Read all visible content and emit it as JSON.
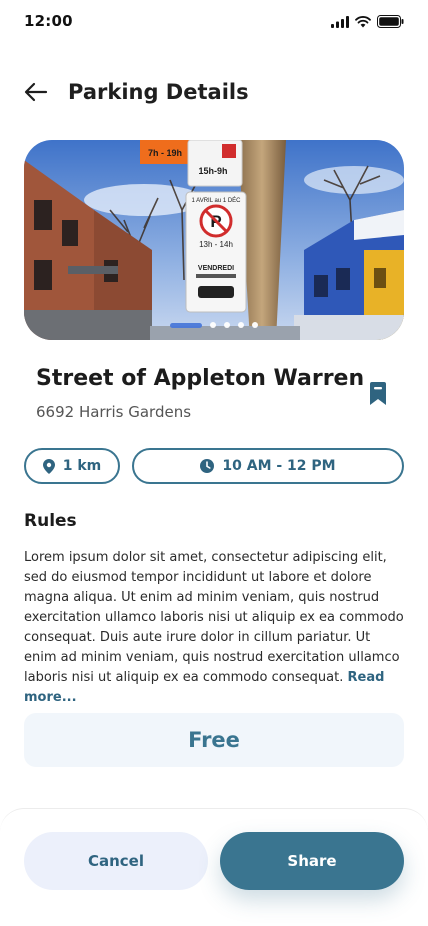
{
  "status_bar": {
    "time": "12:00"
  },
  "header": {
    "title": "Parking Details"
  },
  "hero": {
    "sign_texts": [
      "7h - 19h",
      "15h-9h",
      "1 AVRIL au 1 DÉC",
      "13h - 14h",
      "VENDREDI"
    ],
    "slide_count": 5,
    "active_slide": 1
  },
  "place": {
    "name": "Street of Appleton Warren",
    "address": "6692 Harris Gardens"
  },
  "chips": {
    "distance": "1 km",
    "hours": "10 AM - 12 PM"
  },
  "rules": {
    "heading": "Rules",
    "body": "Lorem ipsum dolor sit amet, consectetur adipiscing elit, sed do eiusmod tempor incididunt ut labore et dolore magna aliqua. Ut enim ad minim veniam, quis nostrud exercitation ullamco laboris nisi ut aliquip ex ea commodo consequat. Duis aute irure dolor in cillum pariatur. Ut enim ad minim veniam, quis nostrud exercitation ullamco laboris nisi ut aliquip ex ea commodo consequat.",
    "read_more": "Read more..."
  },
  "price": {
    "label": "Free"
  },
  "actions": {
    "cancel": "Cancel",
    "share": "Share"
  },
  "colors": {
    "primary": "#3a7590",
    "accent": "#4a78d9",
    "cancel_bg": "#ecf0fb",
    "price_bg": "#f1f6fb"
  },
  "icons": [
    "back-arrow-icon",
    "bookmark-icon",
    "location-pin-icon",
    "clock-icon",
    "signal-icon",
    "wifi-icon",
    "battery-icon"
  ]
}
